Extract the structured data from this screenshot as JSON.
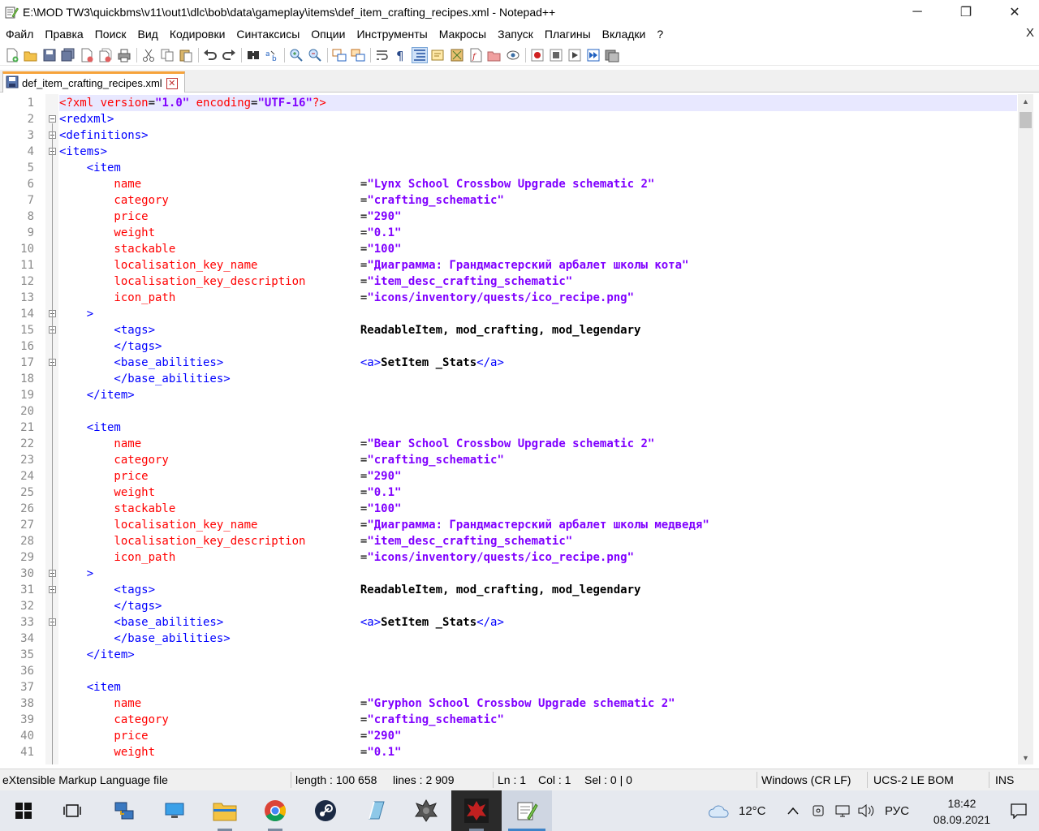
{
  "window": {
    "title": "E:\\MOD TW3\\quickbms\\v11\\out1\\dlc\\bob\\data\\gameplay\\items\\def_item_crafting_recipes.xml - Notepad++",
    "minimize": "─",
    "maximize": "❐",
    "close": "✕"
  },
  "menu": {
    "items": [
      "Файл",
      "Правка",
      "Поиск",
      "Вид",
      "Кодировки",
      "Синтаксисы",
      "Опции",
      "Инструменты",
      "Макросы",
      "Запуск",
      "Плагины",
      "Вкладки",
      "?"
    ],
    "close": "X"
  },
  "tab": {
    "label": "def_item_crafting_recipes.xml",
    "close": "✕"
  },
  "editor": {
    "line_numbers": [
      "1",
      "2",
      "3",
      "4",
      "5",
      "6",
      "7",
      "8",
      "9",
      "10",
      "11",
      "12",
      "13",
      "14",
      "15",
      "16",
      "17",
      "18",
      "19",
      "20",
      "21",
      "22",
      "23",
      "24",
      "25",
      "26",
      "27",
      "28",
      "29",
      "30",
      "31",
      "32",
      "33",
      "34",
      "35",
      "36",
      "37",
      "38",
      "39",
      "40",
      "41"
    ],
    "lines": [
      [
        {
          "c": "pi",
          "t": "<?xml "
        },
        {
          "c": "attr",
          "t": "version"
        },
        {
          "c": "eq",
          "t": "="
        },
        {
          "c": "val",
          "t": "\"1.0\""
        },
        {
          "c": "pi",
          "t": " encoding"
        },
        {
          "c": "eq",
          "t": "="
        },
        {
          "c": "val",
          "t": "\"UTF-16\""
        },
        {
          "c": "pi",
          "t": "?>"
        }
      ],
      [
        {
          "c": "tag",
          "t": "<redxml>"
        }
      ],
      [
        {
          "c": "tag",
          "t": "<definitions>"
        }
      ],
      [
        {
          "c": "tag",
          "t": "<items>"
        }
      ],
      [
        {
          "c": "tag",
          "t": "    <item"
        }
      ],
      [
        {
          "c": "attr",
          "t": "        name                                "
        },
        {
          "c": "eq",
          "t": "="
        },
        {
          "c": "val",
          "t": "\"Lynx School Crossbow Upgrade schematic 2\""
        }
      ],
      [
        {
          "c": "attr",
          "t": "        category                            "
        },
        {
          "c": "eq",
          "t": "="
        },
        {
          "c": "val",
          "t": "\"crafting_schematic\""
        }
      ],
      [
        {
          "c": "attr",
          "t": "        price                               "
        },
        {
          "c": "eq",
          "t": "="
        },
        {
          "c": "val",
          "t": "\"290\""
        }
      ],
      [
        {
          "c": "attr",
          "t": "        weight                              "
        },
        {
          "c": "eq",
          "t": "="
        },
        {
          "c": "val",
          "t": "\"0.1\""
        }
      ],
      [
        {
          "c": "attr",
          "t": "        stackable                           "
        },
        {
          "c": "eq",
          "t": "="
        },
        {
          "c": "val",
          "t": "\"100\""
        }
      ],
      [
        {
          "c": "attr",
          "t": "        localisation_key_name               "
        },
        {
          "c": "eq",
          "t": "="
        },
        {
          "c": "val",
          "t": "\"Диаграмма: Грандмастерский арбалет школы кота\""
        }
      ],
      [
        {
          "c": "attr",
          "t": "        localisation_key_description        "
        },
        {
          "c": "eq",
          "t": "="
        },
        {
          "c": "val",
          "t": "\"item_desc_crafting_schematic\""
        }
      ],
      [
        {
          "c": "attr",
          "t": "        icon_path                           "
        },
        {
          "c": "eq",
          "t": "="
        },
        {
          "c": "val",
          "t": "\"icons/inventory/quests/ico_recipe.png\""
        }
      ],
      [
        {
          "c": "tag",
          "t": "    >"
        }
      ],
      [
        {
          "c": "tag",
          "t": "        <tags>                              "
        },
        {
          "c": "txt",
          "t": "ReadableItem, mod_crafting, mod_legendary"
        }
      ],
      [
        {
          "c": "tag",
          "t": "        </tags>"
        }
      ],
      [
        {
          "c": "tag",
          "t": "        <base_abilities>                    <a>"
        },
        {
          "c": "txt",
          "t": "SetItem _Stats"
        },
        {
          "c": "tag",
          "t": "</a>"
        }
      ],
      [
        {
          "c": "tag",
          "t": "        </base_abilities>"
        }
      ],
      [
        {
          "c": "tag",
          "t": "    </item>"
        }
      ],
      [],
      [
        {
          "c": "tag",
          "t": "    <item"
        }
      ],
      [
        {
          "c": "attr",
          "t": "        name                                "
        },
        {
          "c": "eq",
          "t": "="
        },
        {
          "c": "val",
          "t": "\"Bear School Crossbow Upgrade schematic 2\""
        }
      ],
      [
        {
          "c": "attr",
          "t": "        category                            "
        },
        {
          "c": "eq",
          "t": "="
        },
        {
          "c": "val",
          "t": "\"crafting_schematic\""
        }
      ],
      [
        {
          "c": "attr",
          "t": "        price                               "
        },
        {
          "c": "eq",
          "t": "="
        },
        {
          "c": "val",
          "t": "\"290\""
        }
      ],
      [
        {
          "c": "attr",
          "t": "        weight                              "
        },
        {
          "c": "eq",
          "t": "="
        },
        {
          "c": "val",
          "t": "\"0.1\""
        }
      ],
      [
        {
          "c": "attr",
          "t": "        stackable                           "
        },
        {
          "c": "eq",
          "t": "="
        },
        {
          "c": "val",
          "t": "\"100\""
        }
      ],
      [
        {
          "c": "attr",
          "t": "        localisation_key_name               "
        },
        {
          "c": "eq",
          "t": "="
        },
        {
          "c": "val",
          "t": "\"Диаграмма: Грандмастерский арбалет школы медведя\""
        }
      ],
      [
        {
          "c": "attr",
          "t": "        localisation_key_description        "
        },
        {
          "c": "eq",
          "t": "="
        },
        {
          "c": "val",
          "t": "\"item_desc_crafting_schematic\""
        }
      ],
      [
        {
          "c": "attr",
          "t": "        icon_path                           "
        },
        {
          "c": "eq",
          "t": "="
        },
        {
          "c": "val",
          "t": "\"icons/inventory/quests/ico_recipe.png\""
        }
      ],
      [
        {
          "c": "tag",
          "t": "    >"
        }
      ],
      [
        {
          "c": "tag",
          "t": "        <tags>                              "
        },
        {
          "c": "txt",
          "t": "ReadableItem, mod_crafting, mod_legendary"
        }
      ],
      [
        {
          "c": "tag",
          "t": "        </tags>"
        }
      ],
      [
        {
          "c": "tag",
          "t": "        <base_abilities>                    <a>"
        },
        {
          "c": "txt",
          "t": "SetItem _Stats"
        },
        {
          "c": "tag",
          "t": "</a>"
        }
      ],
      [
        {
          "c": "tag",
          "t": "        </base_abilities>"
        }
      ],
      [
        {
          "c": "tag",
          "t": "    </item>"
        }
      ],
      [],
      [
        {
          "c": "tag",
          "t": "    <item"
        }
      ],
      [
        {
          "c": "attr",
          "t": "        name                                "
        },
        {
          "c": "eq",
          "t": "="
        },
        {
          "c": "val",
          "t": "\"Gryphon School Crossbow Upgrade schematic 2\""
        }
      ],
      [
        {
          "c": "attr",
          "t": "        category                            "
        },
        {
          "c": "eq",
          "t": "="
        },
        {
          "c": "val",
          "t": "\"crafting_schematic\""
        }
      ],
      [
        {
          "c": "attr",
          "t": "        price                               "
        },
        {
          "c": "eq",
          "t": "="
        },
        {
          "c": "val",
          "t": "\"290\""
        }
      ],
      [
        {
          "c": "attr",
          "t": "        weight                              "
        },
        {
          "c": "eq",
          "t": "="
        },
        {
          "c": "val",
          "t": "\"0.1\""
        }
      ]
    ],
    "current_line": 1
  },
  "statusbar": {
    "file_type": "eXtensible Markup Language file",
    "length": "length : 100 658",
    "lines": "lines : 2 909",
    "ln": "Ln : 1",
    "col": "Col : 1",
    "sel": "Sel : 0 | 0",
    "eol": "Windows (CR LF)",
    "encoding": "UCS-2 LE BOM",
    "mode": "INS"
  },
  "taskbar": {
    "weather": "12°C",
    "language": "РУС",
    "time": "18:42",
    "date": "08.09.2021"
  },
  "colors": {
    "tag": "#0000ff",
    "attribute": "#ff0000",
    "value": "#8000ff",
    "current_line": "#e8e8ff",
    "tab_accent": "#f6a33a"
  }
}
